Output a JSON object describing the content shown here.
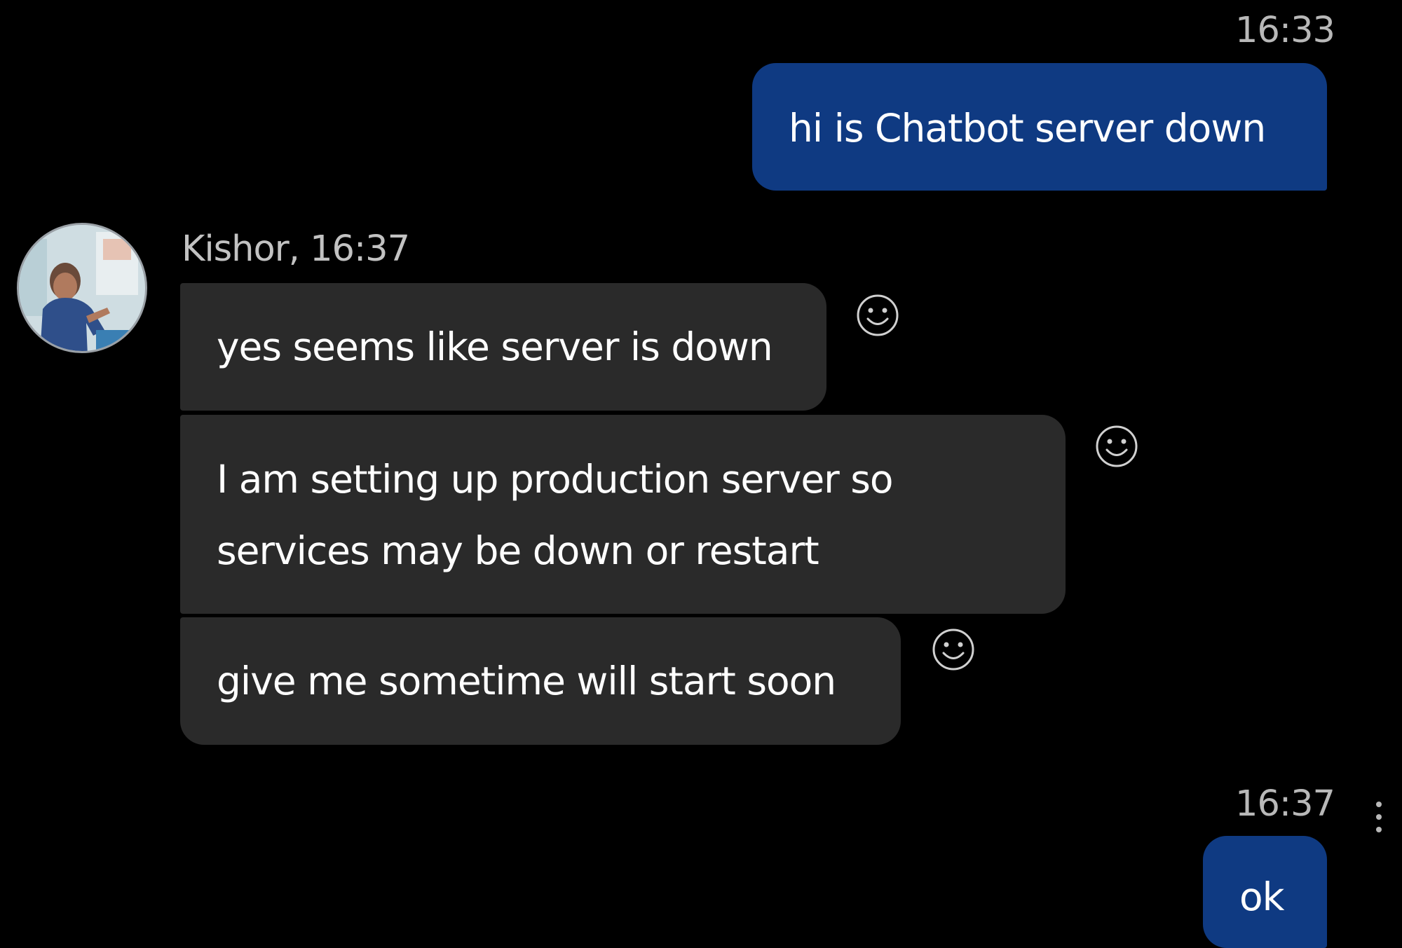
{
  "colors": {
    "background": "#000000",
    "outgoing_bubble": "#0f3a82",
    "incoming_bubble": "#2a2a2a",
    "timestamp_text": "#b8b8b8"
  },
  "messages": {
    "outgoing_1": {
      "time": "16:33",
      "text": "hi is Chatbot server down"
    },
    "incoming_group": {
      "sender_line": "Kishor, 16:37",
      "avatar_icon": "user-avatar",
      "items": [
        {
          "text": "yes seems like server is down",
          "react_icon": "smiley-react-icon"
        },
        {
          "line1": "I am setting up production server so",
          "line2": "services may be  down or restart",
          "react_icon": "smiley-react-icon"
        },
        {
          "text": "give me sometime will start soon",
          "react_icon": "smiley-react-icon"
        }
      ]
    },
    "outgoing_2": {
      "time": "16:37",
      "text": "ok",
      "more_icon": "more-options-icon"
    }
  }
}
